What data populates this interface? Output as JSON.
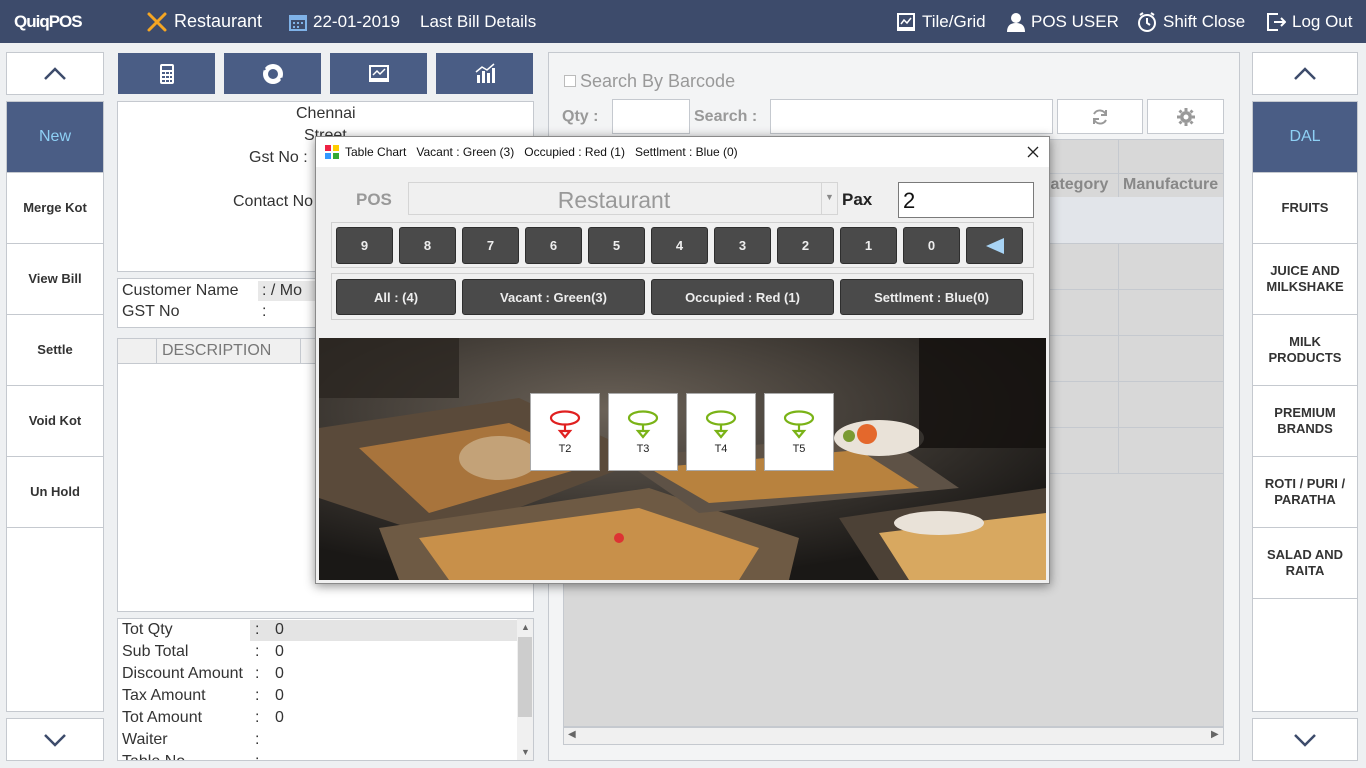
{
  "topbar": {
    "logo_a": "Quiq",
    "logo_b": "POS",
    "section": "Restaurant",
    "date": "22-01-2019",
    "last_bill": "Last Bill Details",
    "tile_grid": "Tile/Grid",
    "user": "POS USER",
    "shift_close": "Shift Close",
    "logout": "Log Out"
  },
  "left_menu": [
    "New",
    "Merge Kot",
    "View Bill",
    "Settle",
    "Void Kot",
    "Un Hold"
  ],
  "right_menu": [
    "DAL",
    "FRUITS",
    "JUICE AND MILKSHAKE",
    "MILK PRODUCTS",
    "PREMIUM BRANDS",
    "ROTI / PURI / PARATHA",
    "SALAD AND RAITA"
  ],
  "bill_header": {
    "city": "Chennai",
    "street": "Street",
    "gst_label": "Gst No :",
    "contact_label": "Contact No"
  },
  "customer": {
    "name_label": "Customer Name",
    "name_value": ":   / Mo",
    "gst_label": "GST No",
    "gst_value": ":"
  },
  "items_table": {
    "col_description": "DESCRIPTION"
  },
  "totals": [
    {
      "label": "Tot Qty",
      "value": "0"
    },
    {
      "label": "Sub Total",
      "value": "0"
    },
    {
      "label": "Discount Amount",
      "value": "0"
    },
    {
      "label": "Tax Amount",
      "value": "0"
    },
    {
      "label": "Tot Amount",
      "value": "0"
    },
    {
      "label": "Waiter",
      "value": ""
    },
    {
      "label": "Table No",
      "value": ""
    }
  ],
  "product_area": {
    "barcode_label": "Search By Barcode",
    "qty_label": "Qty :",
    "search_label": "Search :",
    "col_category": "Category",
    "col_manufacture": "Manufacture"
  },
  "dialog": {
    "title": "Table Chart",
    "stat_vacant": "Vacant : Green (3)",
    "stat_occupied": "Occupied : Red (1)",
    "stat_settlement": "Settlment : Blue (0)",
    "pos_label": "POS",
    "pos_value": "Restaurant",
    "pax_label": "Pax",
    "pax_value": "2",
    "keypad": [
      "9",
      "8",
      "7",
      "6",
      "5",
      "4",
      "3",
      "2",
      "1",
      "0"
    ],
    "filters": {
      "all": "All : (4)",
      "vacant": "Vacant : Green(3)",
      "occupied": "Occupied : Red (1)",
      "settlement": "Settlment : Blue(0)"
    },
    "tables": [
      {
        "name": "T2",
        "status": "occupied",
        "color": "#e02020"
      },
      {
        "name": "T3",
        "status": "vacant",
        "color": "#7ab317"
      },
      {
        "name": "T4",
        "status": "vacant",
        "color": "#7ab317"
      },
      {
        "name": "T5",
        "status": "vacant",
        "color": "#7ab317"
      }
    ]
  },
  "colors": {
    "topbar": "#3d4b6b",
    "button_blue": "#4a5d85",
    "active_text": "#8ed0f5",
    "dark_button": "#4a4a4a"
  }
}
